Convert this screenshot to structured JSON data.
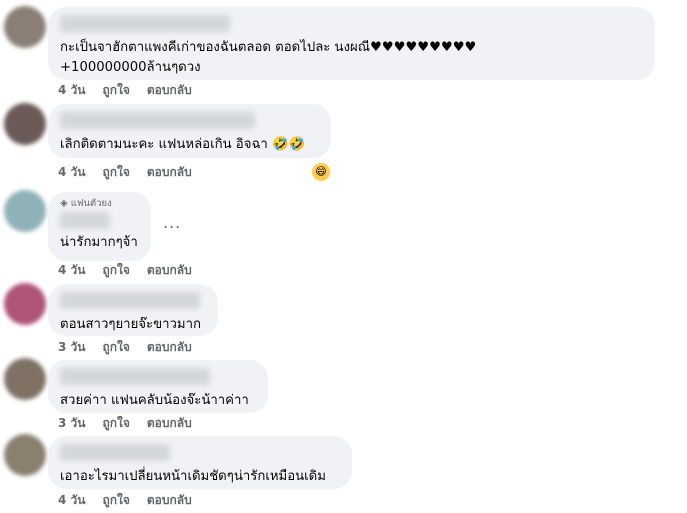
{
  "comments": [
    {
      "text": "กะเป็นจาฮักตาแพงคีเก่าของฉันตลอด ตอดไปละ นงผณี♥♥♥♥♥♥♥♥♥\n+100000000ล้านๆดวง",
      "time": "4 วัน",
      "like": "ถูกใจ",
      "reply": "ตอบกลับ",
      "avatar_color": "#8a7f76"
    },
    {
      "text": "เลิกติดตามนะคะ แฟนหล่อเกิน อิจฉา 🤣🤣",
      "time": "4 วัน",
      "like": "ถูกใจ",
      "reply": "ตอบกลับ",
      "reaction": "😄",
      "avatar_color": "#6b5a57"
    },
    {
      "badge": "แฟนตัวยง",
      "text": "น่ารักมากๆจ้า",
      "time": "4 วัน",
      "like": "ถูกใจ",
      "reply": "ตอบกลับ",
      "more": "...",
      "avatar_color": "#8fb1b8"
    },
    {
      "text": "ตอนสาวๆยายจ๊ะขาวมาก",
      "time": "3 วัน",
      "like": "ถูกใจ",
      "reply": "ตอบกลับ",
      "avatar_color": "#b0547a"
    },
    {
      "text": "สวยค่าา แฟนคลับน้องจ๊ะน้าาค่าา",
      "time": "3 วัน",
      "like": "ถูกใจ",
      "reply": "ตอบกลับ",
      "avatar_color": "#7f7265"
    },
    {
      "text": "เอาอะไรมาเปลี่ยนหน้าเดิมชัดๆน่ารักเหมือนเดิม",
      "time": "4 วัน",
      "like": "ถูกใจ",
      "reply": "ตอบกลับ",
      "avatar_color": "#8a8070"
    }
  ]
}
